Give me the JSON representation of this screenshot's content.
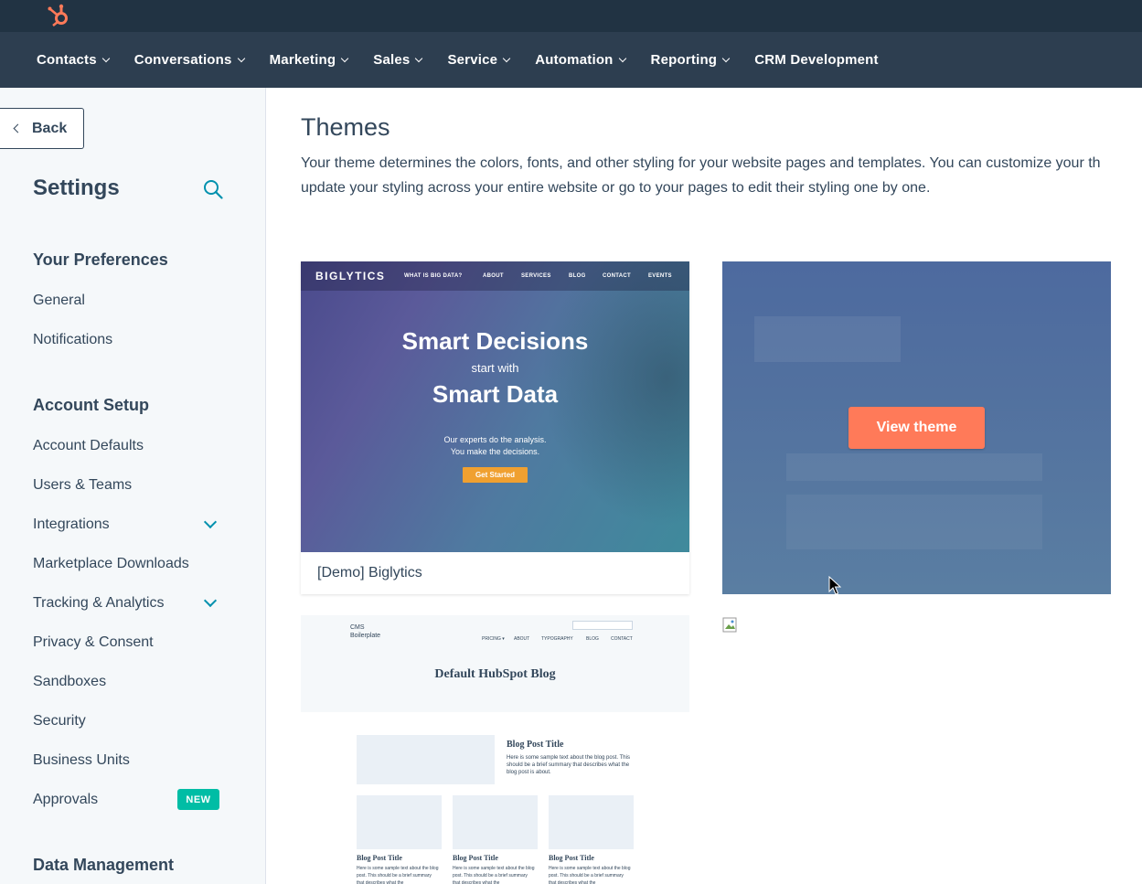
{
  "topbar": {
    "logo_icon": "hubspot-sprocket-icon",
    "brand_color": "#ff7a59"
  },
  "nav": {
    "items": [
      {
        "label": "Contacts",
        "has_dropdown": true
      },
      {
        "label": "Conversations",
        "has_dropdown": true
      },
      {
        "label": "Marketing",
        "has_dropdown": true
      },
      {
        "label": "Sales",
        "has_dropdown": true
      },
      {
        "label": "Service",
        "has_dropdown": true
      },
      {
        "label": "Automation",
        "has_dropdown": true
      },
      {
        "label": "Reporting",
        "has_dropdown": true
      },
      {
        "label": "CRM Development",
        "has_dropdown": false
      }
    ]
  },
  "sidebar": {
    "back_label": "Back",
    "title": "Settings",
    "sections": {
      "preferences": "Your Preferences",
      "account_setup": "Account Setup",
      "data_management": "Data Management"
    },
    "items": {
      "general": "General",
      "notifications": "Notifications",
      "account_defaults": "Account Defaults",
      "users_teams": "Users & Teams",
      "integrations": "Integrations",
      "marketplace_downloads": "Marketplace Downloads",
      "tracking_analytics": "Tracking & Analytics",
      "privacy_consent": "Privacy & Consent",
      "sandboxes": "Sandboxes",
      "security": "Security",
      "business_units": "Business Units",
      "approvals": "Approvals"
    },
    "approvals_badge": "NEW"
  },
  "main": {
    "title": "Themes",
    "description_line1": "Your theme determines the colors, fonts, and other styling for your website pages and templates. You can customize your th",
    "description_line2": "update your styling across your entire website or go to your pages to edit their styling one by one.",
    "themes": [
      {
        "name": "[Demo] Biglytics",
        "preview": {
          "logo": "BIGLYTICS",
          "nav": [
            "WHAT IS BIG DATA?",
            "ABOUT",
            "SERVICES",
            "BLOG",
            "CONTACT",
            "EVENTS"
          ],
          "headline1": "Smart Decisions",
          "subline": "start with",
          "headline2": "Smart Data",
          "body_line1": "Our experts do the analysis.",
          "body_line2": "You make the decisions.",
          "cta": "Get Started"
        }
      },
      {
        "view_button": "View theme"
      },
      {
        "preview": {
          "logo_line1": "CMS",
          "logo_line2": "Boilerplate",
          "nav": [
            "PRICING ▾",
            "ABOUT",
            "TYPOGRAPHY",
            "BLOG",
            "CONTACT"
          ],
          "title": "Default HubSpot Blog",
          "post_title": "Blog Post Title",
          "post_text": "Here is some sample text about the blog post. This should be a brief summary that describes what the blog post is about.",
          "small_post_title": "Blog Post Title",
          "small_post_text": "Here is some sample text about the blog post. This should be a brief summary that describes what the"
        }
      }
    ]
  }
}
